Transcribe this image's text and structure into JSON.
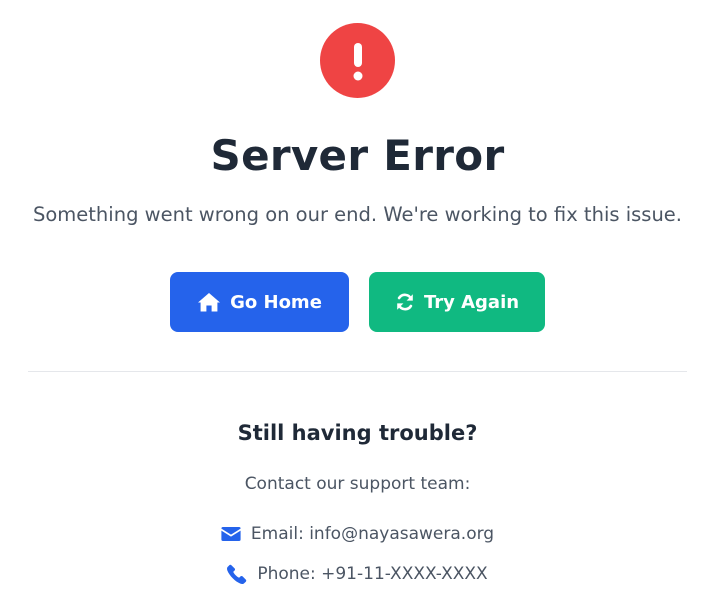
{
  "error": {
    "icon": "exclamation-icon",
    "accent_color": "#ef4444",
    "title": "Server Error",
    "message": "Something went wrong on our end. We're working to fix this issue."
  },
  "actions": {
    "home": {
      "label": "Go Home",
      "icon": "home-icon",
      "color": "#2563eb"
    },
    "retry": {
      "label": "Try Again",
      "icon": "refresh-icon",
      "color": "#10b981"
    }
  },
  "support": {
    "heading": "Still having trouble?",
    "subheading": "Contact our support team:",
    "email": {
      "icon": "envelope-icon",
      "text": "Email: info@nayasawera.org"
    },
    "phone": {
      "icon": "phone-icon",
      "text": "Phone: +91-11-XXXX-XXXX"
    }
  }
}
